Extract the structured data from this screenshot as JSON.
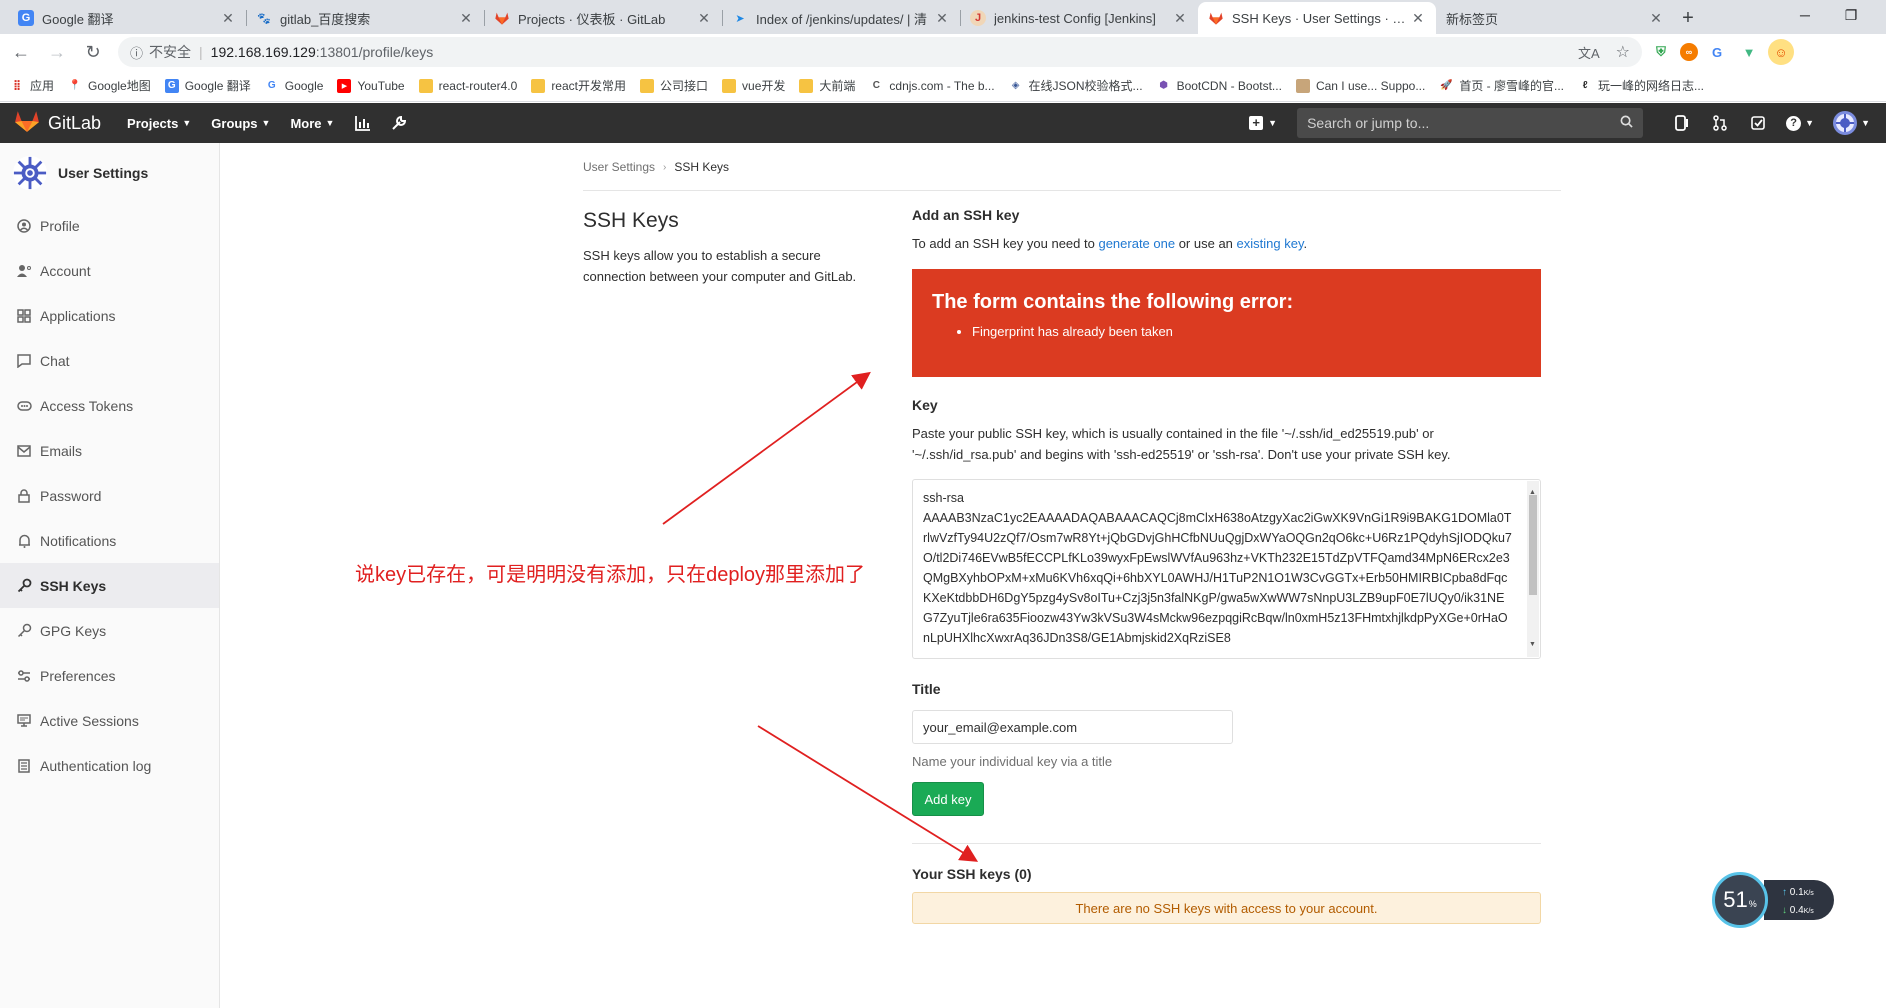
{
  "browser": {
    "tabs": [
      {
        "title": "Google 翻译",
        "icon": "google-translate-icon",
        "color": "#4285f4"
      },
      {
        "title": "gitlab_百度搜索",
        "icon": "baidu-icon",
        "color": "#2932e1"
      },
      {
        "title": "Projects · 仪表板 · GitLab",
        "icon": "gitlab-icon",
        "color": "#e24329"
      },
      {
        "title": "Index of /jenkins/updates/ | 清",
        "icon": "tuna-icon",
        "color": "#1e88e5"
      },
      {
        "title": "jenkins-test Config [Jenkins]",
        "icon": "jenkins-icon",
        "color": "#d33833"
      },
      {
        "title": "SSH Keys · User Settings · GitL",
        "icon": "gitlab-icon",
        "color": "#e24329",
        "active": true
      },
      {
        "title": "新标签页",
        "icon": "",
        "color": ""
      }
    ],
    "address": {
      "insecure_label": "不安全",
      "host": "192.168.169.129",
      "path": ":13801/profile/keys"
    },
    "bookmarks": [
      {
        "label": "应用",
        "icon": "apps-icon",
        "color": "#d93025"
      },
      {
        "label": "Google地图",
        "icon": "maps-icon",
        "color": "#34a853"
      },
      {
        "label": "Google 翻译",
        "icon": "google-translate-icon",
        "color": "#4285f4"
      },
      {
        "label": "Google",
        "icon": "google-icon",
        "color": "#4285f4"
      },
      {
        "label": "YouTube",
        "icon": "youtube-icon",
        "color": "#ff0000"
      },
      {
        "label": "react-router4.0",
        "icon": "folder-icon",
        "color": "#f6c342"
      },
      {
        "label": "react开发常用",
        "icon": "folder-icon",
        "color": "#f6c342"
      },
      {
        "label": "公司接口",
        "icon": "folder-icon",
        "color": "#f6c342"
      },
      {
        "label": "vue开发",
        "icon": "folder-icon",
        "color": "#f6c342"
      },
      {
        "label": "大前端",
        "icon": "folder-icon",
        "color": "#f6c342"
      },
      {
        "label": "cdnjs.com - The b...",
        "icon": "cdnjs-icon",
        "color": "#555555"
      },
      {
        "label": "在线JSON校验格式...",
        "icon": "json-icon",
        "color": "#3b5998"
      },
      {
        "label": "BootCDN - Bootst...",
        "icon": "bootcdn-icon",
        "color": "#7952b3"
      },
      {
        "label": "Can I use... Suppo...",
        "icon": "caniuse-icon",
        "color": "#8a6d3b"
      },
      {
        "label": "首页 - 廖雪峰的官...",
        "icon": "rocket-icon",
        "color": "#1e88e5"
      },
      {
        "label": "玩一峰的网络日志...",
        "icon": "blog-icon",
        "color": "#333333"
      }
    ]
  },
  "gitlab": {
    "brand": "GitLab",
    "nav": [
      "Projects",
      "Groups",
      "More"
    ],
    "search_placeholder": "Search or jump to..."
  },
  "sidebar": {
    "title": "User Settings",
    "items": [
      {
        "label": "Profile",
        "icon": "profile-icon"
      },
      {
        "label": "Account",
        "icon": "account-icon"
      },
      {
        "label": "Applications",
        "icon": "applications-icon"
      },
      {
        "label": "Chat",
        "icon": "chat-icon"
      },
      {
        "label": "Access Tokens",
        "icon": "access-tokens-icon"
      },
      {
        "label": "Emails",
        "icon": "email-icon"
      },
      {
        "label": "Password",
        "icon": "lock-icon"
      },
      {
        "label": "Notifications",
        "icon": "bell-icon"
      },
      {
        "label": "SSH Keys",
        "icon": "key-icon",
        "active": true
      },
      {
        "label": "GPG Keys",
        "icon": "gpg-key-icon"
      },
      {
        "label": "Preferences",
        "icon": "preferences-icon"
      },
      {
        "label": "Active Sessions",
        "icon": "sessions-icon"
      },
      {
        "label": "Authentication log",
        "icon": "log-icon"
      }
    ]
  },
  "page": {
    "breadcrumb": [
      "User Settings",
      "SSH Keys"
    ],
    "heading": "SSH Keys",
    "description": "SSH keys allow you to establish a secure connection between your computer and GitLab.",
    "add_title": "Add an SSH key",
    "add_help_prefix": "To add an SSH key you need to ",
    "add_help_link1": "generate one",
    "add_help_mid": " or use an ",
    "add_help_link2": "existing key",
    "add_help_suffix": ".",
    "error_heading": "The form contains the following error:",
    "error_items": [
      "Fingerprint has already been taken"
    ],
    "key_label": "Key",
    "key_help": "Paste your public SSH key, which is usually contained in the file '~/.ssh/id_ed25519.pub' or '~/.ssh/id_rsa.pub' and begins with 'ssh-ed25519' or 'ssh-rsa'. Don't use your private SSH key.",
    "key_value_line1": "ssh-rsa",
    "key_value_rest": "AAAAB3NzaC1yc2EAAAADAQABAAACAQCj8mClxH638oAtzgyXac2iGwXK9VnGi1R9i9BAKG1DOMla0TrlwVzfTy94U2zQf7/Osm7wR8Yt+jQbGDvjGhHCfbNUuQgjDxWYaOQGn2qO6kc+U6Rz1PQdyhSjIODQku7O/tl2Di746EVwB5fECCPLfKLo39wyxFpEwslWVfAu963hz+VKTh232E15TdZpVTFQamd34MpN6ERcx2e3QMgBXyhbOPxM+xMu6KVh6xqQi+6hbXYL0AWHJ/H1TuP2N1O1W3CvGGTx+Erb50HMIRBICpba8dFqcKXeKtdbbDH6DgY5pzg4ySv8oITu+Czj3j5n3falNKgP/gwa5wXwWW7sNnpU3LZB9upF0E7lUQy0/ik31NEG7ZyuTjle6ra635Fioozw43Yw3kVSu3W4sMckw96ezpqgiRcBqw/ln0xmH5z13FHmtxhjlkdpPyXGe+0rHaOnLpUHXlhcXwxrAq36JDn3S8/GE1Abmjskid2XqRziSE8",
    "title_label": "Title",
    "title_value": "your_email@example.com",
    "title_help": "Name your individual key via a title",
    "add_button": "Add key",
    "your_keys": "Your SSH keys (0)",
    "no_keys": "There are no SSH keys with access to your account."
  },
  "annotation": {
    "text": "说key已存在，可是明明没有添加，只在deploy那里添加了",
    "color": "#e02020"
  },
  "net_widget": {
    "percent": "51",
    "percent_unit": "%",
    "up": "0.1",
    "down": "0.4",
    "unit": "K/s"
  },
  "colors": {
    "gitlab_header": "#303030",
    "error_bg": "#db3b21",
    "success_btn": "#1aaa55",
    "link": "#1f78d1",
    "warning_bg": "#fdf1dd"
  }
}
